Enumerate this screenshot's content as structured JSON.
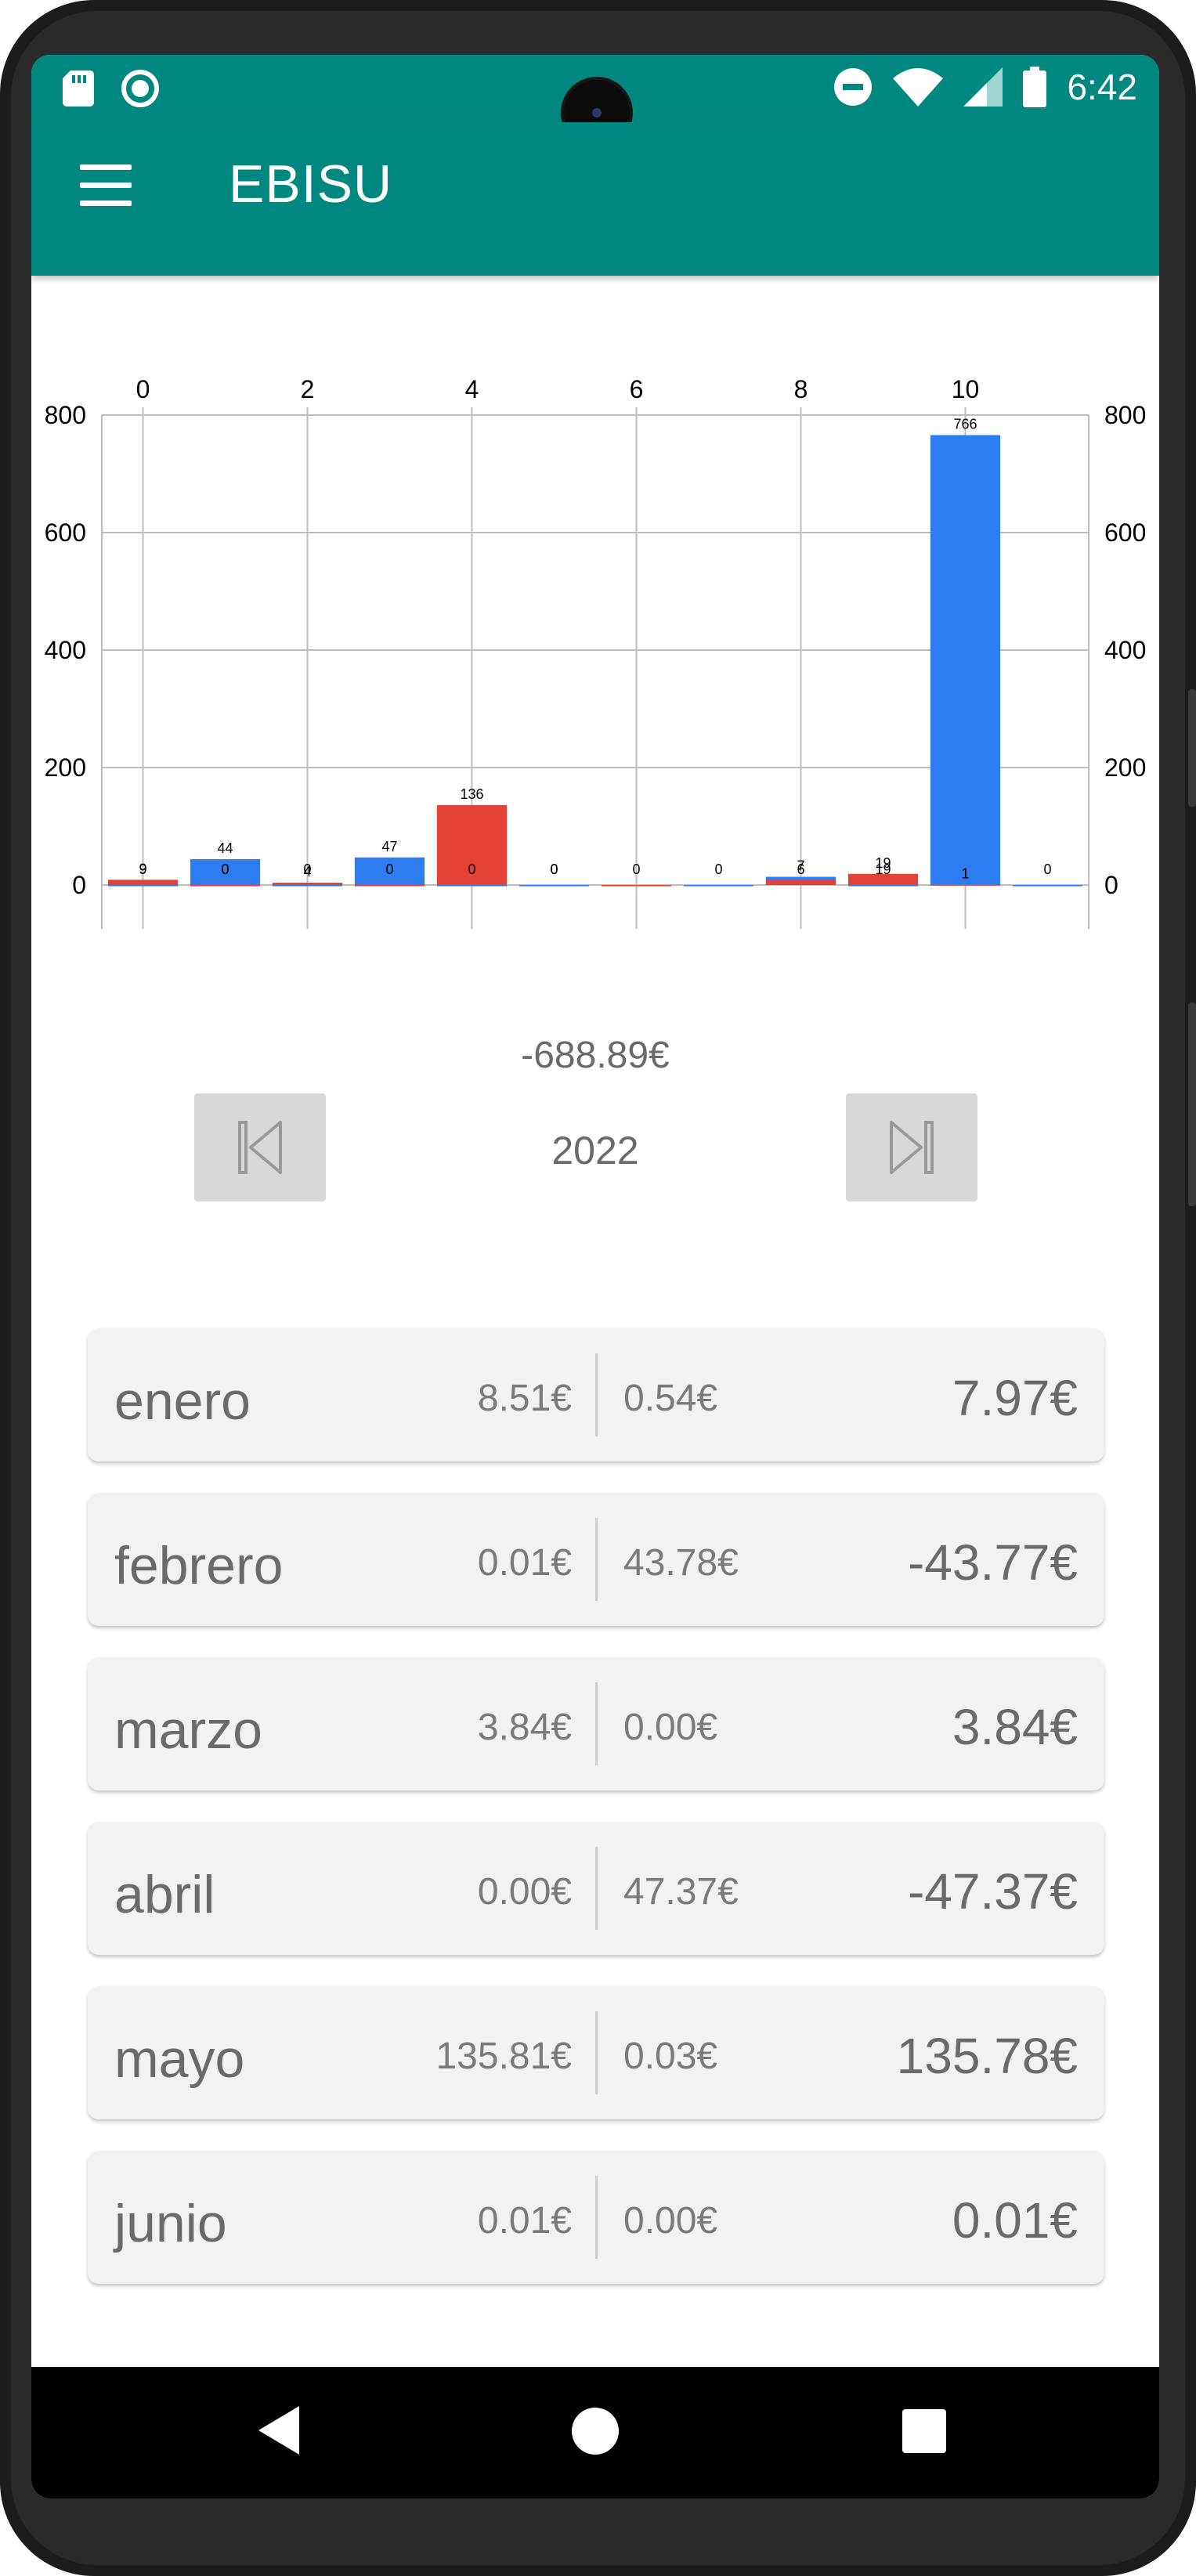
{
  "status_bar": {
    "time": "6:42",
    "left_icons": [
      "sd-card-icon",
      "radio-icon"
    ],
    "right_icons": [
      "dnd-icon",
      "wifi-icon",
      "signal-icon",
      "battery-icon"
    ]
  },
  "app_bar": {
    "title": "EBISU",
    "menu_icon": "menu-icon"
  },
  "chart_data": {
    "type": "bar",
    "x": [
      0,
      1,
      2,
      3,
      4,
      5,
      6,
      7,
      8,
      9,
      10,
      11
    ],
    "xlim": [
      -0.5,
      11.5
    ],
    "x_ticks": [
      "0",
      "2",
      "4",
      "6",
      "8",
      "10"
    ],
    "ylim": [
      0,
      800
    ],
    "y_ticks": [
      "0",
      "200",
      "400",
      "600",
      "800"
    ],
    "grid": true,
    "bars": [
      {
        "x": 0,
        "value": 9,
        "label": "9",
        "color": "#e34234"
      },
      {
        "x": 0,
        "value": 0,
        "label": "9",
        "color": "#2e7df0"
      },
      {
        "x": 1,
        "value": 44,
        "label": "44",
        "color": "#2e7df0"
      },
      {
        "x": 1,
        "value": 0,
        "label": "0",
        "color": "#e34234"
      },
      {
        "x": 2,
        "value": 4,
        "label": "4",
        "color": "#e34234"
      },
      {
        "x": 2,
        "value": 0,
        "label": "0",
        "color": "#2e7df0"
      },
      {
        "x": 3,
        "value": 47,
        "label": "47",
        "color": "#2e7df0"
      },
      {
        "x": 3,
        "value": 0,
        "label": "0",
        "color": "#e34234"
      },
      {
        "x": 4,
        "value": 136,
        "label": "136",
        "color": "#e34234"
      },
      {
        "x": 4,
        "value": 0,
        "label": "0",
        "color": "#2e7df0"
      },
      {
        "x": 5,
        "value": 0,
        "label": "0",
        "color": "#e34234"
      },
      {
        "x": 5,
        "value": 0,
        "label": "0",
        "color": "#2e7df0"
      },
      {
        "x": 6,
        "value": 0,
        "label": "0",
        "color": "#e34234"
      },
      {
        "x": 7,
        "value": 0,
        "label": "0",
        "color": "#2e7df0"
      },
      {
        "x": 8,
        "value": 14,
        "label": "7",
        "color": "#2e7df0"
      },
      {
        "x": 8,
        "value": 8,
        "label": "6",
        "color": "#e34234"
      },
      {
        "x": 9,
        "value": 19,
        "label": "19",
        "color": "#e34234"
      },
      {
        "x": 9,
        "value": 0,
        "label": "19",
        "color": "#2e7df0"
      },
      {
        "x": 10,
        "value": 766,
        "label": "766",
        "color": "#2e7df0"
      },
      {
        "x": 10,
        "value": 1,
        "label": "1",
        "color": "#e34234"
      },
      {
        "x": 11,
        "value": 0,
        "label": "0",
        "color": "#2e7df0"
      }
    ]
  },
  "summary": {
    "total": "-688.89€"
  },
  "year_nav": {
    "year": "2022",
    "prev_icon": "skip-previous-icon",
    "next_icon": "skip-next-icon"
  },
  "months": [
    {
      "name": "enero",
      "income": "8.51€",
      "expense": "0.54€",
      "balance": "7.97€"
    },
    {
      "name": "febrero",
      "income": "0.01€",
      "expense": "43.78€",
      "balance": "-43.77€"
    },
    {
      "name": "marzo",
      "income": "3.84€",
      "expense": "0.00€",
      "balance": "3.84€"
    },
    {
      "name": "abril",
      "income": "0.00€",
      "expense": "47.37€",
      "balance": "-47.37€"
    },
    {
      "name": "mayo",
      "income": "135.81€",
      "expense": "0.03€",
      "balance": "135.78€"
    },
    {
      "name": "junio",
      "income": "0.01€",
      "expense": "0.00€",
      "balance": "0.01€"
    }
  ],
  "nav_bar": {
    "back_icon": "back-icon",
    "home_icon": "home-icon",
    "recents_icon": "recents-icon"
  },
  "colors": {
    "primary": "#00877f",
    "income_bar": "#2e7df0",
    "expense_bar": "#e34234"
  }
}
